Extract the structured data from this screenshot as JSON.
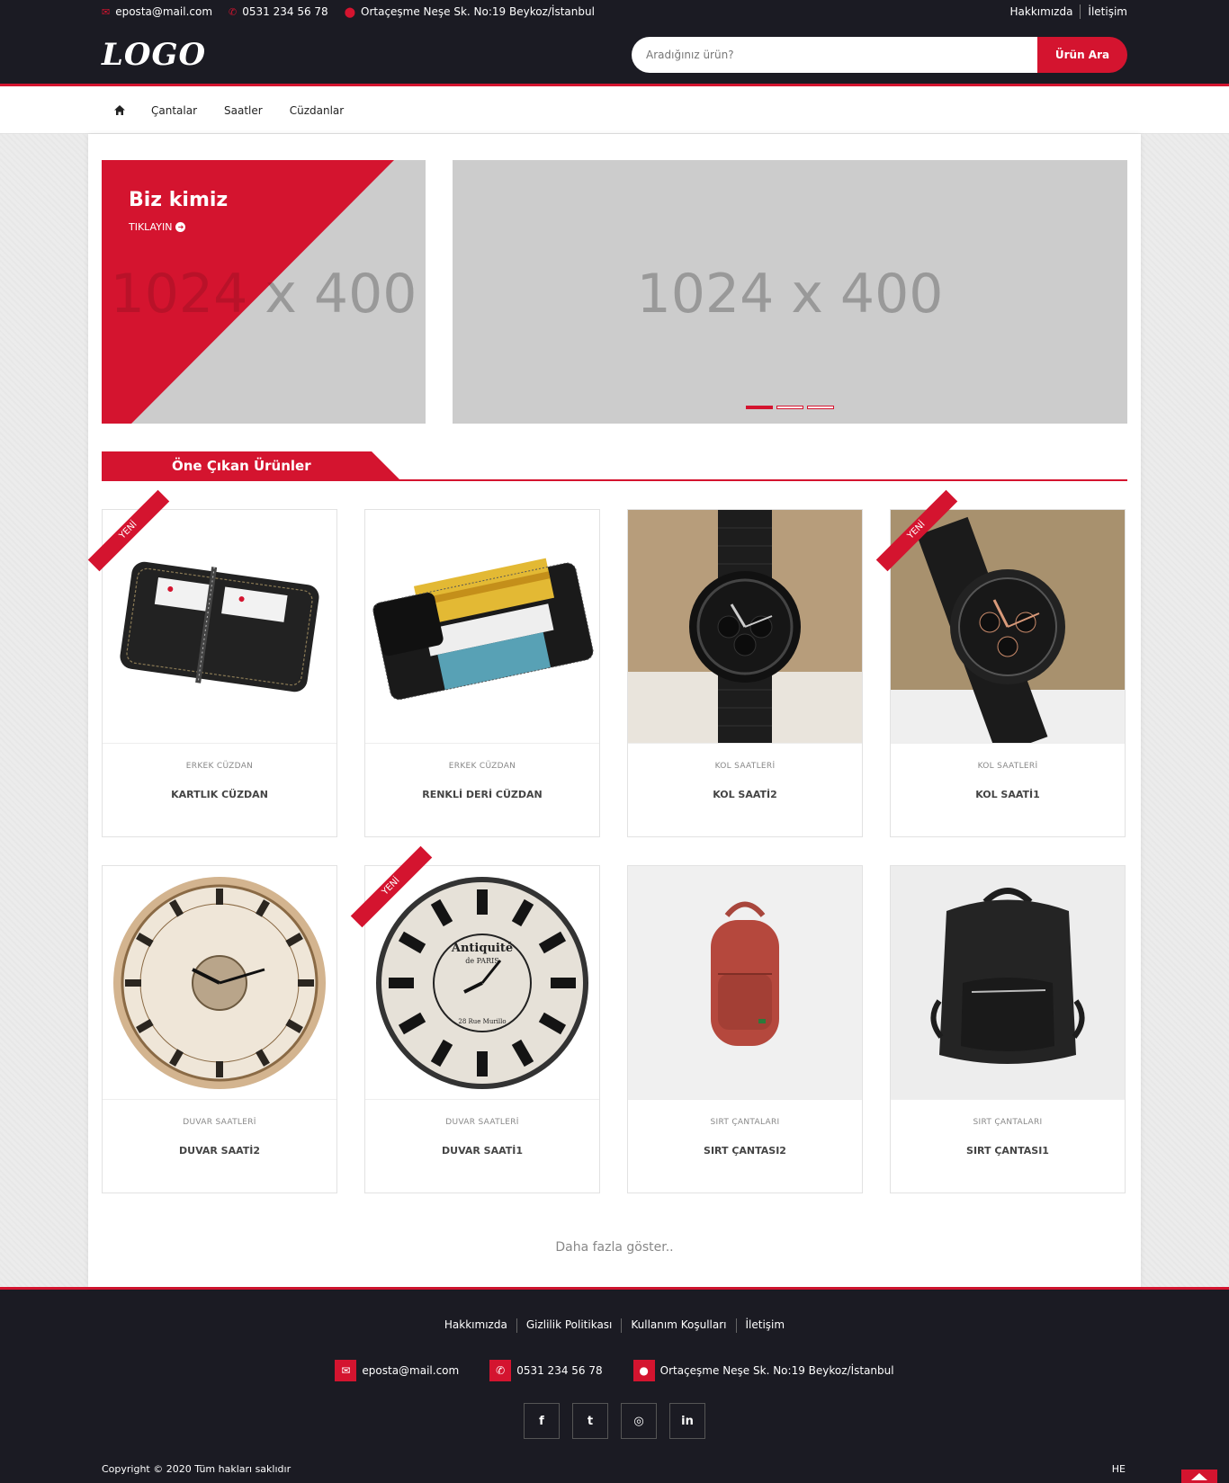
{
  "topbar": {
    "email": "eposta@mail.com",
    "phone": "0531 234 56 78",
    "address": "Ortaçeşme Neşe Sk. No:19 Beykoz/İstanbul",
    "links": [
      "Hakkımızda",
      "İletişim"
    ]
  },
  "header": {
    "logo": "LOGO",
    "search_placeholder": "Aradığınız ürün?",
    "search_button": "Ürün Ara"
  },
  "nav": {
    "home_icon": "home-icon",
    "items": [
      "Çantalar",
      "Saatler",
      "Cüzdanlar"
    ]
  },
  "hero": {
    "promo_title": "Biz kimiz",
    "promo_cta": "TIKLAYIN",
    "promo_placeholder": "1024 x 400",
    "slider_placeholder": "1024 x 400",
    "slider_dots": 3,
    "slider_active": 0
  },
  "section": {
    "title": "Öne Çıkan Ürünler"
  },
  "products": [
    {
      "category": "ERKEK CÜZDAN",
      "title": "KARTLIK CÜZDAN",
      "new": true,
      "ribbon": "YENİ",
      "img": "wallet-black"
    },
    {
      "category": "ERKEK CÜZDAN",
      "title": "RENKLİ DERİ CÜZDAN",
      "new": false,
      "ribbon": "",
      "img": "wallet-cards"
    },
    {
      "category": "KOL SAATLERİ",
      "title": "KOL SAATİ2",
      "new": false,
      "ribbon": "",
      "img": "watch-bracelet"
    },
    {
      "category": "KOL SAATLERİ",
      "title": "KOL SAATİ1",
      "new": true,
      "ribbon": "YENİ",
      "img": "watch-mesh"
    },
    {
      "category": "DUVAR SAATLERİ",
      "title": "DUVAR SAATİ2",
      "new": false,
      "ribbon": "",
      "img": "clock-vintage"
    },
    {
      "category": "DUVAR SAATLERİ",
      "title": "DUVAR SAATİ1",
      "new": true,
      "ribbon": "YENİ",
      "img": "clock-antiquite"
    },
    {
      "category": "SIRT ÇANTALARI",
      "title": "SIRT ÇANTASI2",
      "new": false,
      "ribbon": "",
      "img": "backpack-red"
    },
    {
      "category": "SIRT ÇANTALARI",
      "title": "SIRT ÇANTASI1",
      "new": false,
      "ribbon": "",
      "img": "backpack-black"
    }
  ],
  "clock_labels": {
    "brand": "Antiquité",
    "city": "de PARIS",
    "street": "28 Rue Murillo"
  },
  "more": "Daha fazla göster..",
  "footer": {
    "links": [
      "Hakkımızda",
      "Gizlilik Politikası",
      "Kullanım Koşulları",
      "İletişim"
    ],
    "email": "eposta@mail.com",
    "phone": "0531 234 56 78",
    "address": "Ortaçeşme Neşe Sk. No:19 Beykoz/İstanbul",
    "social": [
      "f",
      "t",
      "◎",
      "in"
    ],
    "copyright": "Copyright © 2020 Tüm hakları saklıdır",
    "lang": "HE"
  },
  "colors": {
    "accent": "#d4142f",
    "dark": "#1b1b23",
    "placeholder": "#cccccc"
  }
}
